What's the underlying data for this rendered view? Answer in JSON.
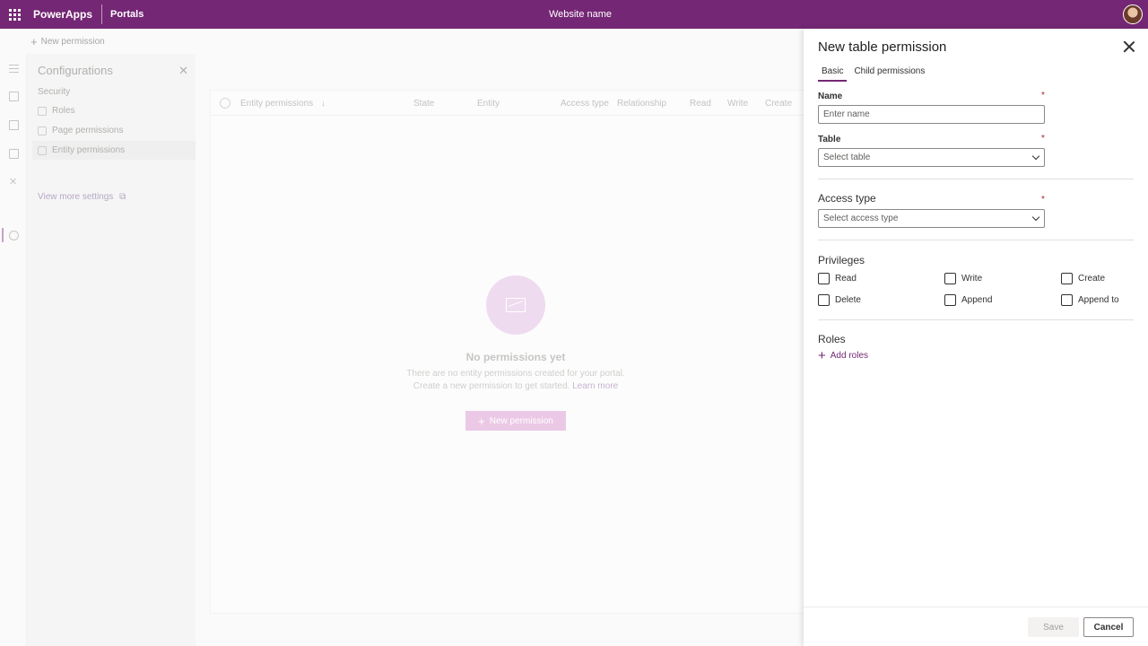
{
  "header": {
    "brand": "PowerApps",
    "product": "Portals",
    "site_name": "Website name"
  },
  "background": {
    "command_bar": {
      "new_permission_label": "New permission"
    },
    "config_panel": {
      "title": "Configurations",
      "section": "Security",
      "items": [
        {
          "label": "Roles"
        },
        {
          "label": "Page permissions"
        },
        {
          "label": "Entity permissions"
        }
      ],
      "view_more": "View more settings"
    },
    "grid": {
      "columns": [
        "Entity permissions",
        "State",
        "Entity",
        "Access type",
        "Relationship",
        "Read",
        "Write",
        "Create"
      ],
      "sort_indicator": "↓"
    },
    "empty_state": {
      "title": "No permissions yet",
      "line1": "There are no entity permissions created for your portal.",
      "line2": "Create a new permission to get started.",
      "learn_more": "Learn more",
      "button_label": "New permission"
    }
  },
  "panel": {
    "title": "New table permission",
    "tabs": [
      {
        "label": "Basic",
        "active": true
      },
      {
        "label": "Child permissions",
        "active": false
      }
    ],
    "name": {
      "label": "Name",
      "placeholder": "Enter name",
      "required_mark": "*"
    },
    "table": {
      "label": "Table",
      "placeholder": "Select table",
      "required_mark": "*"
    },
    "access_type": {
      "label": "Access type",
      "placeholder": "Select access type",
      "required_mark": "*"
    },
    "privileges": {
      "label": "Privileges",
      "items": [
        {
          "label": "Read",
          "checked": false
        },
        {
          "label": "Write",
          "checked": false
        },
        {
          "label": "Create",
          "checked": false
        },
        {
          "label": "Delete",
          "checked": false
        },
        {
          "label": "Append",
          "checked": false
        },
        {
          "label": "Append to",
          "checked": false
        }
      ]
    },
    "roles": {
      "label": "Roles",
      "add_label": "Add roles"
    },
    "footer": {
      "save_label": "Save",
      "cancel_label": "Cancel"
    }
  },
  "colors": {
    "brand": "#742774",
    "required": "#a4262c"
  }
}
